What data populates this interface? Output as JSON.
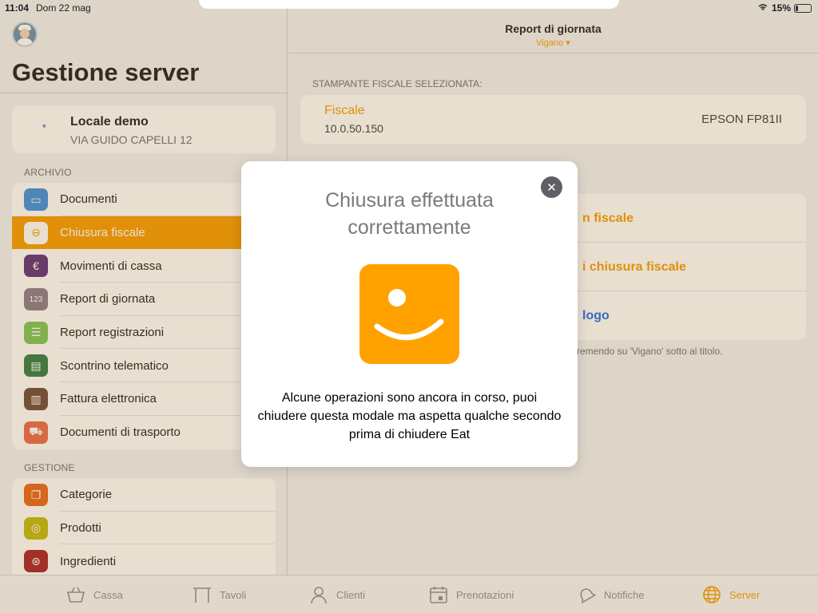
{
  "status_bar": {
    "time": "11:04",
    "date": "Dom 22 mag",
    "battery": "15%",
    "battery_level": 0.15
  },
  "sidebar": {
    "title": "Gestione server",
    "locale": {
      "name": "Locale demo",
      "address": "VIA GUIDO CAPELLI 12"
    },
    "sections": [
      {
        "label": "ARCHIVIO",
        "items": [
          {
            "label": "Documenti",
            "icon": "folder-icon",
            "color": "#3b8ee0"
          },
          {
            "label": "Chiusura fiscale",
            "icon": "circle-minus-icon",
            "color": "#f59a00",
            "selected": true
          },
          {
            "label": "Movimenti di cassa",
            "icon": "euro-icon",
            "color": "#5b2f7a"
          },
          {
            "label": "Report di giornata",
            "icon": "numbers-icon",
            "color": "#8a7a8c"
          },
          {
            "label": "Report registrazioni",
            "icon": "list-icon",
            "color": "#7cc45a"
          },
          {
            "label": "Scontrino telematico",
            "icon": "receipt-icon",
            "color": "#2f7a46"
          },
          {
            "label": "Fattura elettronica",
            "icon": "invoice-icon",
            "color": "#6b4a3a",
            "badge": true
          },
          {
            "label": "Documenti di trasporto",
            "icon": "truck-icon",
            "color": "#e8674a"
          }
        ]
      },
      {
        "label": "GESTIONE",
        "items": [
          {
            "label": "Categorie",
            "icon": "stack-icon",
            "color": "#e8651a"
          },
          {
            "label": "Prodotti",
            "icon": "product-icon",
            "color": "#c2b810"
          },
          {
            "label": "Ingredienti",
            "icon": "ingredients-icon",
            "color": "#a61f2a"
          }
        ]
      }
    ]
  },
  "main": {
    "nav_title": "Report di giornata",
    "nav_subtitle": "Vigano ▾",
    "printer_label": "STAMPANTE FISCALE SELEZIONATA:",
    "printer": {
      "name": "Fiscale",
      "ip": "10.0.50.150",
      "model": "EPSON FP81II"
    },
    "actions": [
      {
        "label": "n fiscale",
        "color": "orange"
      },
      {
        "label": "i chiusura fiscale",
        "color": "orange"
      },
      {
        "label": "logo",
        "color": "blue"
      }
    ],
    "hint": "remendo su 'Vigano' sotto al titolo."
  },
  "tabbar": {
    "tabs": [
      {
        "label": "Cassa",
        "icon": "basket-icon"
      },
      {
        "label": "Tavoli",
        "icon": "table-icon"
      },
      {
        "label": "Clienti",
        "icon": "person-icon"
      },
      {
        "label": "Prenotazioni",
        "icon": "calendar-icon"
      },
      {
        "label": "Notifiche",
        "icon": "bell-icon"
      },
      {
        "label": "Server",
        "icon": "globe-icon",
        "active": true
      }
    ]
  },
  "modal": {
    "title": "Chiusura effettuata correttamente",
    "message": "Alcune operazioni sono ancora in corso, puoi chiudere questa modale ma aspetta qualche secondo prima di chiudere Eat",
    "close_icon": "close-icon",
    "logo_color": "#ffa200"
  }
}
